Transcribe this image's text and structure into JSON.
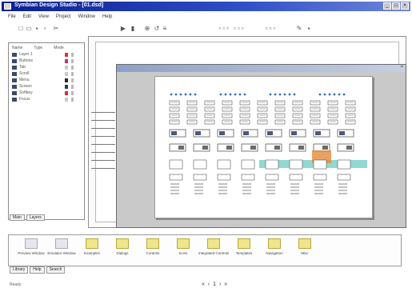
{
  "window": {
    "title": "Symbian Design Studio - [01.dsd]",
    "controls": [
      "_",
      "□",
      "×"
    ]
  },
  "menu": [
    "File",
    "Edit",
    "View",
    "Project",
    "Window",
    "Help"
  ],
  "toolbar": {
    "icons": [
      "new-icon",
      "open-icon",
      "save-icon",
      "print-icon",
      "cut-icon",
      "pointer-icon",
      "select-icon",
      "zoom-icon",
      "rotate-icon",
      "align-icon",
      "group-icon",
      "pencil-icon",
      "grid-icon"
    ]
  },
  "layers_panel": {
    "headers": [
      "Name",
      "Type",
      "Mode"
    ],
    "rows": [
      {
        "name": "Layer 1",
        "color": "#d23a3a"
      },
      {
        "name": "Buttons",
        "color": "#c0307a"
      },
      {
        "name": "Tab",
        "color": "#c8c8c8"
      },
      {
        "name": "Scroll",
        "color": "#c8c8c8"
      },
      {
        "name": "Menu",
        "color": "#2a2a2a"
      },
      {
        "name": "Screen",
        "color": "#3a3a3a"
      },
      {
        "name": "Softkey",
        "color": "#d03030"
      },
      {
        "name": "Focus",
        "color": "#c8c8c8"
      }
    ],
    "tabs": [
      "Main",
      "Layers"
    ]
  },
  "tray": {
    "items": [
      {
        "label": "Preview Window",
        "kind": "grey"
      },
      {
        "label": "Emulator Window",
        "kind": "grey"
      },
      {
        "label": "Examples",
        "kind": "folder"
      },
      {
        "label": "Dialogs",
        "kind": "folder"
      },
      {
        "label": "Controls",
        "kind": "folder"
      },
      {
        "label": "Icons",
        "kind": "folder"
      },
      {
        "label": "Integrated Controls",
        "kind": "folder"
      },
      {
        "label": "Templates",
        "kind": "folder"
      },
      {
        "label": "Navigation",
        "kind": "folder"
      },
      {
        "label": "Misc",
        "kind": "folder"
      }
    ],
    "tabs": [
      "Library",
      "Help",
      "Search"
    ]
  },
  "status": {
    "left": "Ready",
    "nav": "« ‹ 1 › »"
  }
}
